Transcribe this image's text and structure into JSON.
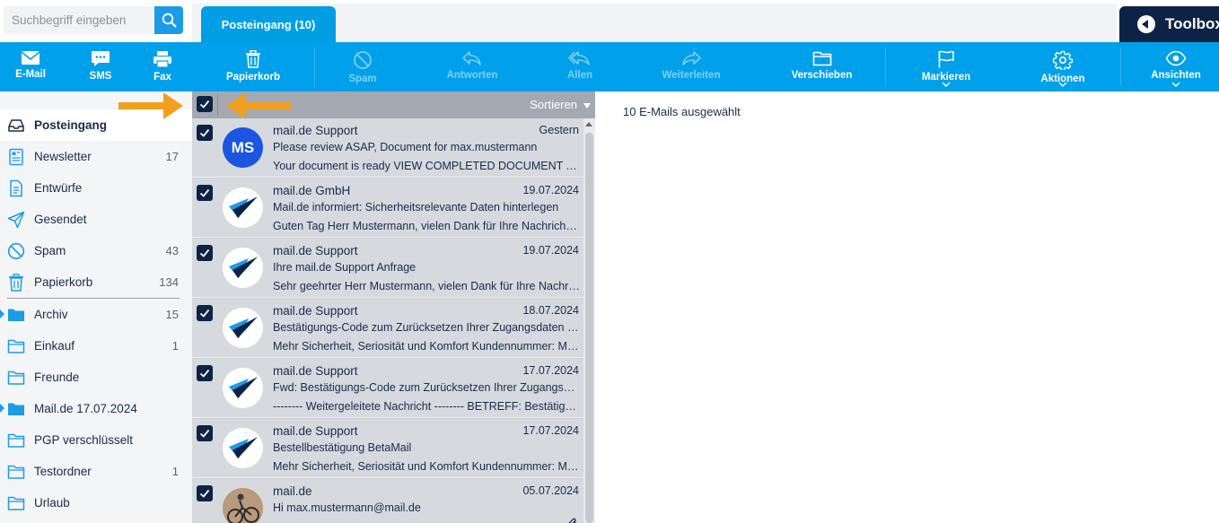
{
  "search": {
    "placeholder": "Suchbegriff eingeben"
  },
  "tabs": {
    "inbox_label": "Posteingang (10)"
  },
  "toolbox": {
    "label": "Toolbox"
  },
  "toolbar": {
    "email": "E-Mail",
    "sms": "SMS",
    "fax": "Fax",
    "trash": "Papierkorb",
    "spam": "Spam",
    "reply": "Antworten",
    "reply_all": "Allen",
    "forward": "Weiterleiten",
    "move": "Verschieben",
    "flag": "Markieren",
    "actions": "Aktionen",
    "views": "Ansichten"
  },
  "sidebar": {
    "folders": [
      {
        "name": "Posteingang",
        "count": ""
      },
      {
        "name": "Newsletter",
        "count": "17"
      },
      {
        "name": "Entwürfe",
        "count": ""
      },
      {
        "name": "Gesendet",
        "count": ""
      },
      {
        "name": "Spam",
        "count": "43"
      },
      {
        "name": "Papierkorb",
        "count": "134"
      },
      {
        "name": "Archiv",
        "count": "15"
      },
      {
        "name": "Einkauf",
        "count": "1"
      },
      {
        "name": "Freunde",
        "count": ""
      },
      {
        "name": "Mail.de 17.07.2024",
        "count": ""
      },
      {
        "name": "PGP verschlüsselt",
        "count": ""
      },
      {
        "name": "Testordner",
        "count": "1"
      },
      {
        "name": "Urlaub",
        "count": ""
      }
    ]
  },
  "list": {
    "sort_label": "Sortieren",
    "mails": [
      {
        "avatar_text": "MS",
        "sender": "mail.de Support",
        "date": "Gestern",
        "subject": "Please review ASAP, Document for max.mustermann",
        "preview": "Your document is ready VIEW COMPLETED DOCUMENT Thank you for using DocuSign"
      },
      {
        "avatar_text": "",
        "sender": "mail.de GmbH",
        "date": "19.07.2024",
        "subject": "Mail.de informiert: Sicherheitsrelevante Daten hinterlegen",
        "preview": "Guten Tag Herr Mustermann, vielen Dank für Ihre Nachricht an den Support"
      },
      {
        "avatar_text": "",
        "sender": "mail.de Support",
        "date": "19.07.2024",
        "subject": "Ihre mail.de Support Anfrage",
        "preview": "Sehr geehrter Herr Mustermann, vielen Dank für Ihre Nachricht an den Support"
      },
      {
        "avatar_text": "",
        "sender": "mail.de Support",
        "date": "18.07.2024",
        "subject": "Bestätigungs-Code zum Zurücksetzen Ihrer Zugangsdaten bei mail.de",
        "preview": "Mehr Sicherheit, Seriosität und Komfort Kundennummer: Max Mustermann"
      },
      {
        "avatar_text": "",
        "sender": "mail.de Support",
        "date": "17.07.2024",
        "subject": "Fwd: Bestätigungs-Code zum Zurücksetzen Ihrer Zugangsdaten bei mail.de",
        "preview": "-------- Weitergeleitete Nachricht -------- BETREFF: Bestätigungs-Code"
      },
      {
        "avatar_text": "",
        "sender": "mail.de Support",
        "date": "17.07.2024",
        "subject": "Bestellbestätigung BetaMail",
        "preview": "Mehr Sicherheit, Seriosität und Komfort Kundennummer: Max Mustermann"
      },
      {
        "avatar_text": "",
        "sender": "mail.de",
        "date": "05.07.2024",
        "subject": "Hi max.mustermann@mail.de",
        "preview": ""
      }
    ]
  },
  "detail": {
    "selection_text": "10 E-Mails ausgewählt"
  },
  "colors": {
    "toolbar": "#00a0ea",
    "dark": "#0c2346",
    "annotation_arrow": "#f0a01e"
  }
}
